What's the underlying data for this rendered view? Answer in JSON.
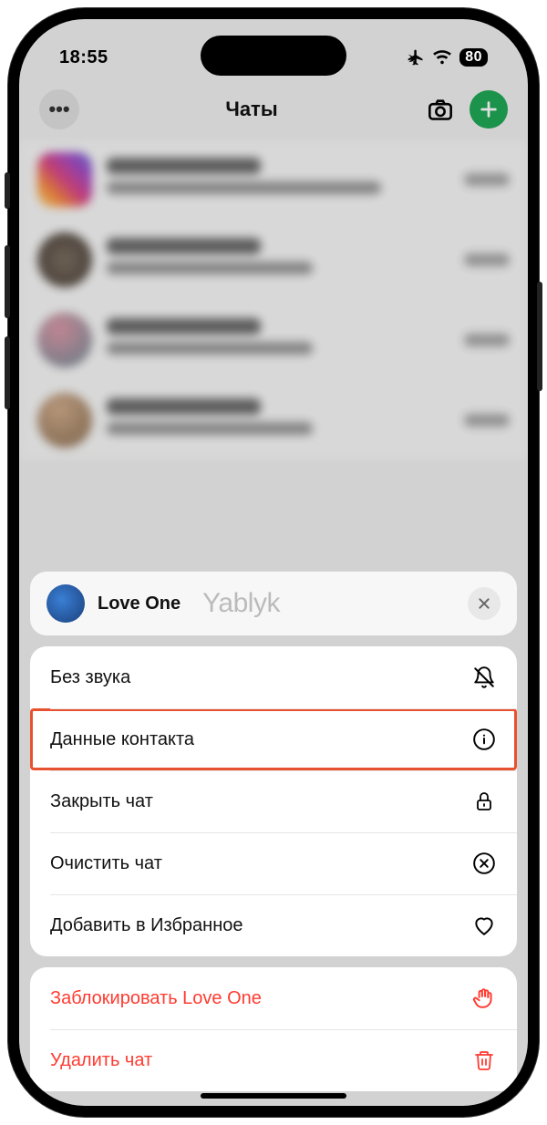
{
  "status": {
    "time": "18:55",
    "battery": "80"
  },
  "nav": {
    "title": "Чаты"
  },
  "menu": {
    "name": "Love One",
    "watermark": "Yablyk",
    "items": {
      "mute": "Без звука",
      "contact_info": "Данные контакта",
      "close_chat": "Закрыть чат",
      "clear_chat": "Очистить чат",
      "add_fav": "Добавить в Избранное"
    },
    "danger": {
      "block": "Заблокировать Love One",
      "delete": "Удалить чат"
    }
  }
}
